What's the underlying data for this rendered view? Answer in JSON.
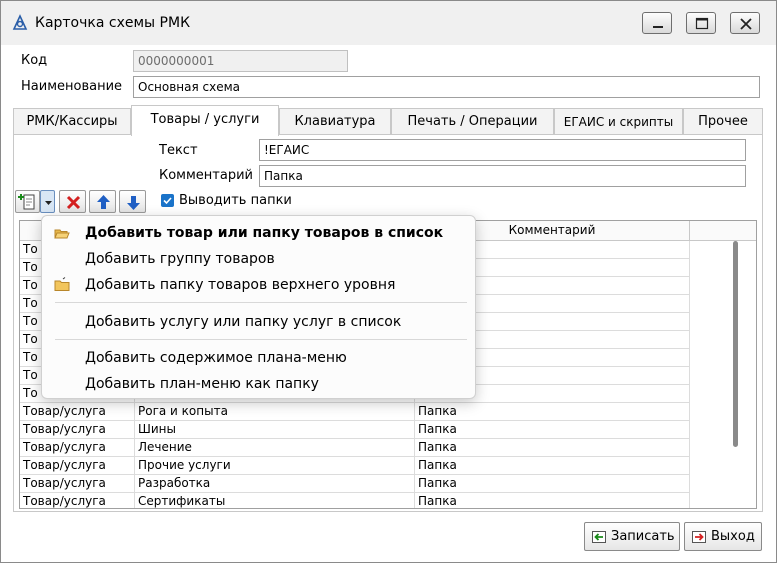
{
  "window": {
    "title": "Карточка схемы РМК"
  },
  "form": {
    "code_label": "Код",
    "code_value": "0000000001",
    "name_label": "Наименование",
    "name_value": "Основная схема"
  },
  "tabs": [
    {
      "label": "РМК/Кассиры"
    },
    {
      "label": "Товары / услуги"
    },
    {
      "label": "Клавиатура"
    },
    {
      "label": "Печать / Операции"
    },
    {
      "label": "ЕГАИС и скрипты"
    },
    {
      "label": "Прочее"
    }
  ],
  "goods_tab": {
    "text_label": "Текст",
    "text_value": "!ЕГАИС",
    "comment_label": "Комментарий",
    "comment_value": "Папка",
    "show_folders_label": "Выводить папки",
    "show_folders_checked": true
  },
  "grid": {
    "columns": [
      "",
      "",
      "Комментарий"
    ],
    "rows": [
      {
        "type": "То",
        "name": "",
        "comment": ""
      },
      {
        "type": "То",
        "name": "",
        "comment": ""
      },
      {
        "type": "То",
        "name": "",
        "comment": ""
      },
      {
        "type": "То",
        "name": "",
        "comment": ""
      },
      {
        "type": "То",
        "name": "",
        "comment": ""
      },
      {
        "type": "То",
        "name": "",
        "comment": ""
      },
      {
        "type": "То",
        "name": "",
        "comment": ""
      },
      {
        "type": "То",
        "name": "",
        "comment": ""
      },
      {
        "type": "То",
        "name": "",
        "comment": ""
      },
      {
        "type": "Товар/услуга",
        "name": "Рога и копыта",
        "comment": "Папка"
      },
      {
        "type": "Товар/услуга",
        "name": "Шины",
        "comment": "Папка"
      },
      {
        "type": "Товар/услуга",
        "name": "Лечение",
        "comment": "Папка"
      },
      {
        "type": "Товар/услуга",
        "name": "Прочие услуги",
        "comment": "Папка"
      },
      {
        "type": "Товар/услуга",
        "name": "Разработка",
        "comment": "Папка"
      },
      {
        "type": "Товар/услуга",
        "name": "Сертификаты",
        "comment": "Папка"
      }
    ]
  },
  "menu": {
    "items": [
      {
        "label": "Добавить товар или папку товаров в список",
        "icon": "open-folder-icon",
        "bold": true
      },
      {
        "label": "Добавить группу товаров",
        "icon": "",
        "bold": false
      },
      {
        "label": "Добавить папку товаров верхнего уровня",
        "icon": "folder-icon",
        "bold": false
      },
      {
        "label": "Добавить услугу или папку услуг в список",
        "icon": "",
        "bold": false
      },
      {
        "label": "Добавить содержимое плана-меню",
        "icon": "",
        "bold": false
      },
      {
        "label": "Добавить план-меню как папку",
        "icon": "",
        "bold": false
      }
    ]
  },
  "footer": {
    "save_label": "Записать",
    "exit_label": "Выход"
  },
  "colors": {
    "accent": "#1a73c9",
    "delete": "#d42020",
    "arrow": "#1f5fc4"
  }
}
